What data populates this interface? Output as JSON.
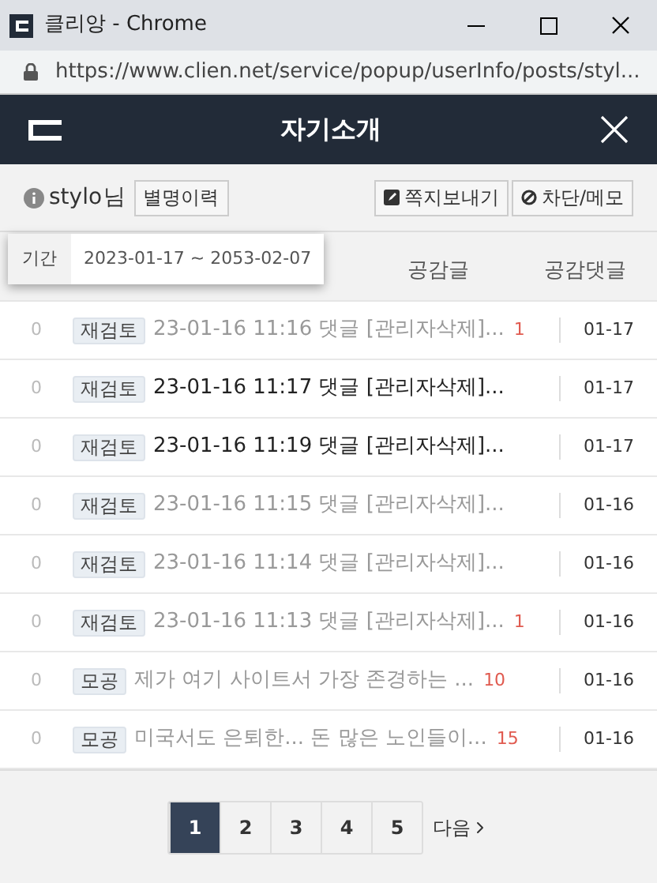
{
  "window": {
    "title": "클리앙 - Chrome",
    "url": "https://www.clien.net/service/popup/userInfo/posts/styl..."
  },
  "header": {
    "title": "자기소개"
  },
  "user": {
    "name": "stylo",
    "suffix": "님",
    "nick_history": "별명이력",
    "message_button": "쪽지보내기",
    "block_button": "차단/메모"
  },
  "period_popup": {
    "label": "기간",
    "value": "2023-01-17 ~ 2053-02-07"
  },
  "tabs": [
    {
      "label": "공감글",
      "selected": false
    },
    {
      "label": "공감댓글",
      "selected": false
    }
  ],
  "rows": [
    {
      "likes": "0",
      "tag": "재검토",
      "title": "23-01-16 11:16 댓글 [관리자삭제]...",
      "comments": "1",
      "date": "01-17",
      "read": true
    },
    {
      "likes": "0",
      "tag": "재검토",
      "title": "23-01-16 11:17 댓글 [관리자삭제]...",
      "date": "01-17",
      "read": false
    },
    {
      "likes": "0",
      "tag": "재검토",
      "title": "23-01-16 11:19 댓글 [관리자삭제]...",
      "date": "01-17",
      "read": false
    },
    {
      "likes": "0",
      "tag": "재검토",
      "title": "23-01-16 11:15 댓글 [관리자삭제]...",
      "date": "01-16",
      "read": true
    },
    {
      "likes": "0",
      "tag": "재검토",
      "title": "23-01-16 11:14 댓글 [관리자삭제]...",
      "date": "01-16",
      "read": true
    },
    {
      "likes": "0",
      "tag": "재검토",
      "title": "23-01-16 11:13 댓글 [관리자삭제]...",
      "comments": "1",
      "date": "01-16",
      "read": true
    },
    {
      "likes": "0",
      "tag": "모공",
      "title": "제가 여기 사이트서 가장 존경하는 ...",
      "comments": "10",
      "date": "01-16",
      "read": true
    },
    {
      "likes": "0",
      "tag": "모공",
      "title": "미국서도 은퇴한... 돈 많은 노인들이...",
      "comments": "15",
      "date": "01-16",
      "read": true
    }
  ],
  "pagination": {
    "pages": [
      {
        "label": "1",
        "selected": true
      },
      {
        "label": "2",
        "selected": false
      },
      {
        "label": "3",
        "selected": false
      },
      {
        "label": "4",
        "selected": false
      },
      {
        "label": "5",
        "selected": false
      }
    ],
    "next": "다음"
  }
}
